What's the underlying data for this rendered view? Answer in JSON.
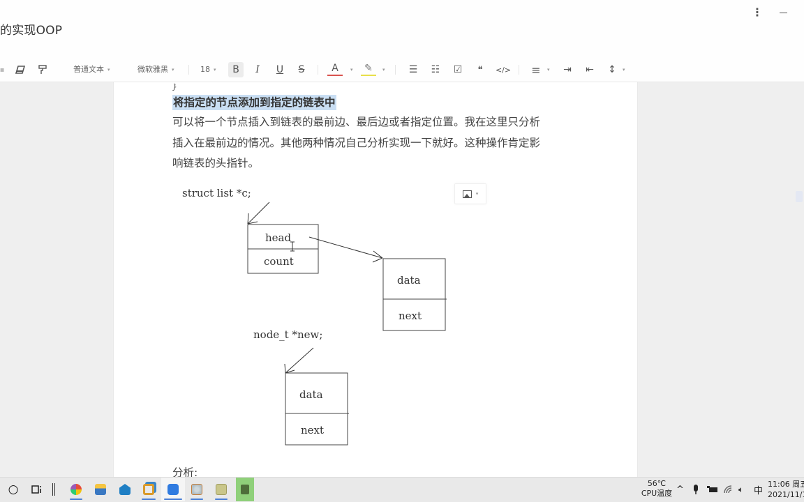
{
  "window": {
    "doc_title": "的实现OOP",
    "more_label": "⋮",
    "minimize_label": ""
  },
  "toolbar": {
    "paragraph_style": "普通文本",
    "font_family": "微软雅黑",
    "font_size": "18",
    "caret": "▾",
    "icons": {
      "eraser": "eraser-icon",
      "format_painter": "format-painter-icon",
      "bold": "B",
      "italic": "I",
      "underline": "U",
      "strike": "S",
      "font_color": "A",
      "highlight": "✎",
      "bullet_list": "☰",
      "number_list": "☷",
      "checkbox": "☑",
      "quote": "❝",
      "code": "</>",
      "align": "≡",
      "indent": "⇥",
      "outdent": "⇤",
      "line_height": "↕"
    },
    "font_color_accent": "#d9534f",
    "highlight_accent": "#e8e04a"
  },
  "document": {
    "fragment": "}",
    "heading": "将指定的节点添加到指定的链表中",
    "paragraph_lines": [
      "可以将一个节点插入到链表的最前边、最后边或者指定位置。我在这里只分析",
      "插入在最前边的情况。其他两种情况自己分析实现一下就好。这种操作肯定影",
      "响链表的头指针。"
    ],
    "analysis_label": "分析:",
    "highlight_color": "#c9def3"
  },
  "diagram": {
    "list_decl": "struct list *c;",
    "list_fields": [
      "head",
      "count"
    ],
    "node1_fields": [
      "data",
      "next"
    ],
    "new_decl": "node_t *new;",
    "node2_fields": [
      "data",
      "next"
    ]
  },
  "taskbar": {
    "start_icon": "○",
    "cpu_temp": "56℃",
    "cpu_label": "CPU温度",
    "tray_chevron": "^",
    "ime": "中",
    "time": "11:06 周五",
    "date": "2021/11/1"
  }
}
